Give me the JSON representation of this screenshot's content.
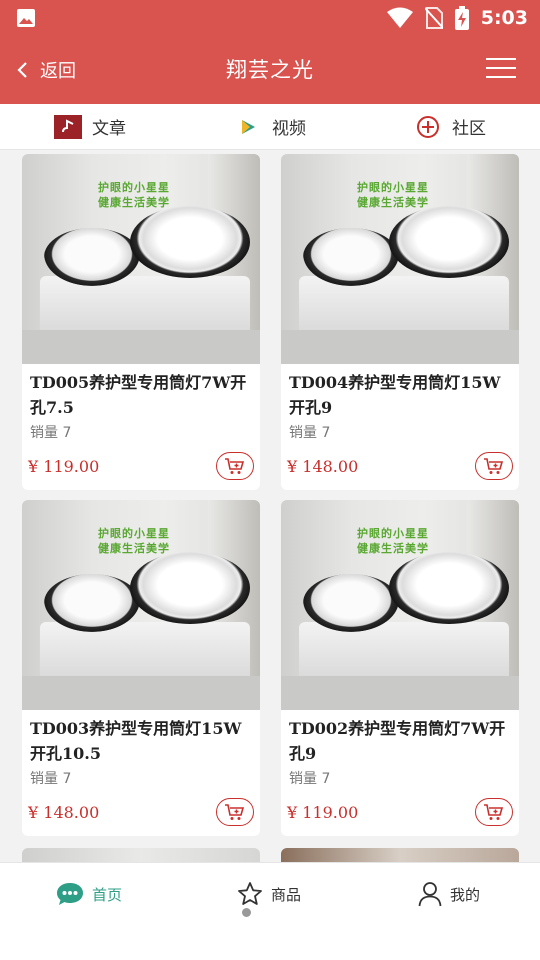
{
  "status_bar": {
    "time": "5:03",
    "icons": [
      "gallery-icon",
      "wifi-icon",
      "no-sim-icon",
      "battery-charging-icon"
    ]
  },
  "header": {
    "back_label": "返回",
    "title": "翔芸之光",
    "menu_icon": "hamburger-menu-icon",
    "background": "#d9534f"
  },
  "categories": [
    {
      "label": "文章",
      "icon": "article-icon"
    },
    {
      "label": "视频",
      "icon": "video-play-icon"
    },
    {
      "label": "社区",
      "icon": "community-icon"
    }
  ],
  "products": [
    {
      "name": "TD005养护型专用筒灯7W开孔7.5",
      "sales": "销量 7",
      "price": "¥ 119.00",
      "image_text": [
        "护眼的小星星",
        "健康生活美学"
      ]
    },
    {
      "name": "TD004养护型专用筒灯15W开孔9",
      "sales": "销量 7",
      "price": "¥ 148.00",
      "image_text": [
        "护眼的小星星",
        "健康生活美学"
      ]
    },
    {
      "name": "TD003养护型专用筒灯15W开孔10.5",
      "sales": "销量 7",
      "price": "¥ 148.00",
      "image_text": [
        "护眼的小星星",
        "健康生活美学"
      ]
    },
    {
      "name": "TD002养护型专用筒灯7W开孔9",
      "sales": "销量 7",
      "price": "¥ 119.00",
      "image_text": [
        "护眼的小星星",
        "健康生活美学"
      ]
    }
  ],
  "bottom_nav": [
    {
      "label": "首页",
      "icon": "chat-bubble-icon",
      "active": true
    },
    {
      "label": "商品",
      "icon": "star-icon",
      "active": false
    },
    {
      "label": "我的",
      "icon": "user-icon",
      "active": false
    }
  ],
  "colors": {
    "accent": "#d9534f",
    "price": "#c9302c",
    "active_nav": "#2e9e86"
  }
}
